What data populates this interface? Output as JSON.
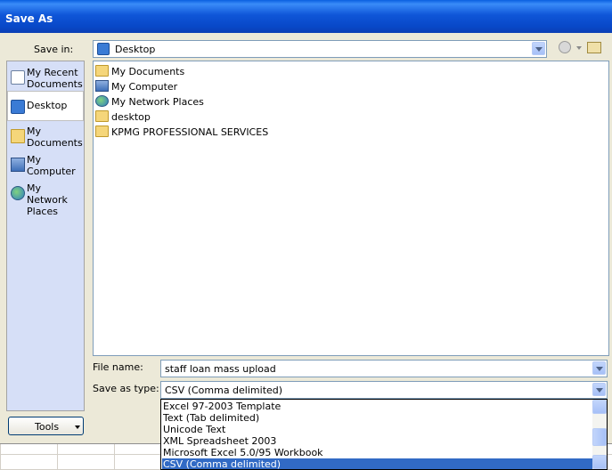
{
  "dialog": {
    "title": "Save As",
    "save_in_label": "Save in:",
    "save_in_value": "Desktop"
  },
  "places": [
    {
      "label": "My Recent Documents",
      "icon": "recent-documents-icon"
    },
    {
      "label": "Desktop",
      "icon": "desktop-icon",
      "selected": true
    },
    {
      "label": "My Documents",
      "icon": "my-documents-icon"
    },
    {
      "label": "My Computer",
      "icon": "my-computer-icon"
    },
    {
      "label": "My Network Places",
      "icon": "network-places-icon"
    }
  ],
  "files": [
    {
      "name": "My Documents",
      "icon": "folder-icon"
    },
    {
      "name": "My Computer",
      "icon": "computer-icon"
    },
    {
      "name": "My Network Places",
      "icon": "network-icon"
    },
    {
      "name": "desktop",
      "icon": "folder-icon"
    },
    {
      "name": "KPMG PROFESSIONAL SERVICES",
      "icon": "folder-icon"
    }
  ],
  "file_name": {
    "label": "File name:",
    "value": "staff loan mass upload"
  },
  "save_type": {
    "label": "Save as type:",
    "value": "CSV (Comma delimited)",
    "options": [
      "Excel 97-2003 Template",
      "Text (Tab delimited)",
      "Unicode Text",
      "XML Spreadsheet 2003",
      "Microsoft Excel 5.0/95 Workbook",
      "CSV (Comma delimited)"
    ],
    "selected_index": 5
  },
  "tools": {
    "label": "Tools"
  },
  "colors": {
    "titlebar": "#0a54d8",
    "selection": "#316ac5",
    "dialog_bg": "#ece9d8",
    "places_bg": "#d6dff7"
  }
}
